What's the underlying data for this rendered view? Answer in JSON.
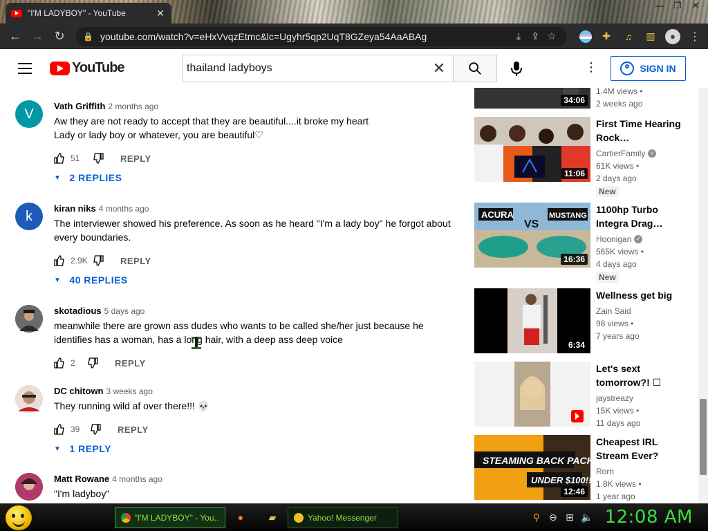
{
  "browser": {
    "tab_title": "\"I'M LADYBOY\" - YouTube",
    "tab_close": "✕",
    "url": "youtube.com/watch?v=eHxVvqzEtmc&lc=Ugyhr5qp2UqT8GZeya54AaABAg",
    "win_min": "—",
    "win_max": "❐",
    "win_close": "✕"
  },
  "masthead": {
    "logo_text": "YouTube",
    "search_value": "thailand ladyboys",
    "signin_label": "SIGN IN"
  },
  "comments": [
    {
      "author": "Vath Griffith",
      "time": "2 months ago",
      "avatar_letter": "V",
      "avatar_color": "#0097a7",
      "text_lines": [
        "Aw they are not ready to accept that they are beautiful....it broke my heart",
        "Lady or lady boy or whatever, you are beautiful♡"
      ],
      "likes": "51",
      "reply_label": "REPLY",
      "replies_label": "2 REPLIES"
    },
    {
      "author": "kiran niks",
      "time": "4 months ago",
      "avatar_letter": "k",
      "avatar_color": "#1e5bb8",
      "text_lines": [
        "The interviewer showed his preference. As soon as he heard \"I'm a lady boy\" he forgot about",
        "every boundaries."
      ],
      "likes": "2.9K",
      "reply_label": "REPLY",
      "replies_label": "40 REPLIES"
    },
    {
      "author": "skotadious",
      "time": "5 days ago",
      "avatar_letter": "",
      "avatar_color": "#5a5a5a",
      "text_lines": [
        "meanwhile there are grown ass dudes who wants to be called she/her just because he",
        "identifies has a woman, has a long hair, with a deep ass deep voice"
      ],
      "likes": "2",
      "reply_label": "REPLY",
      "replies_label": ""
    },
    {
      "author": "DC chitown",
      "time": "3 weeks ago",
      "avatar_letter": "",
      "avatar_color": "#d9c4b0",
      "text_lines": [
        "They running wild af over there!!! 💀"
      ],
      "likes": "39",
      "reply_label": "REPLY",
      "replies_label": "1 REPLY"
    },
    {
      "author": "Matt Rowane",
      "time": "4 months ago",
      "avatar_letter": "",
      "avatar_color": "#b03a6a",
      "text_lines": [
        "\"I'm ladyboy\""
      ],
      "likes": "",
      "reply_label": "",
      "replies_label": ""
    }
  ],
  "sidebar": [
    {
      "title": "",
      "channel": "",
      "verified": false,
      "views": "1.4M views •",
      "age": "2 weeks ago",
      "duration": "34:06",
      "badge": "",
      "thumb_colors": [
        "#1a1a1a",
        "#3a3a3a"
      ]
    },
    {
      "title": "First Time Hearing Rock…",
      "channel": "CartierFamily",
      "verified": true,
      "views": "61K views •",
      "age": "2 days ago",
      "duration": "11:06",
      "badge": "New",
      "thumb_colors": [
        "#c9c2b6",
        "#e05a2a"
      ]
    },
    {
      "title": "1100hp Turbo Integra Drag…",
      "channel": "Hoonigan",
      "verified": true,
      "views": "565K views •",
      "age": "4 days ago",
      "duration": "16:36",
      "badge": "New",
      "thumb_colors": [
        "#8fb8d8",
        "#1f8f7a"
      ]
    },
    {
      "title": "Wellness get big",
      "channel": "Zain Said",
      "verified": false,
      "views": "98 views •",
      "age": "7 years ago",
      "duration": "6:34",
      "badge": "",
      "thumb_colors": [
        "#000000",
        "#d8d0c8"
      ]
    },
    {
      "title": "Let's sext tomorrow?! ☐",
      "channel": "jaystreazy",
      "verified": false,
      "views": "15K views •",
      "age": "11 days ago",
      "duration": "",
      "badge": "",
      "thumb_colors": [
        "#f2f2f2",
        "#c9b49a"
      ]
    },
    {
      "title": "Cheapest IRL Stream Ever?",
      "channel": "Rorn",
      "verified": false,
      "views": "1.8K views •",
      "age": "1 year ago",
      "duration": "12:46",
      "badge": "",
      "thumb_colors": [
        "#f0a010",
        "#1a1a1a"
      ]
    }
  ],
  "taskbar": {
    "task_browser": "\"I'M LADYBOY\" - You...",
    "task_yahoo": "Yahoo! Messenger",
    "clock": "12:08 AM"
  }
}
